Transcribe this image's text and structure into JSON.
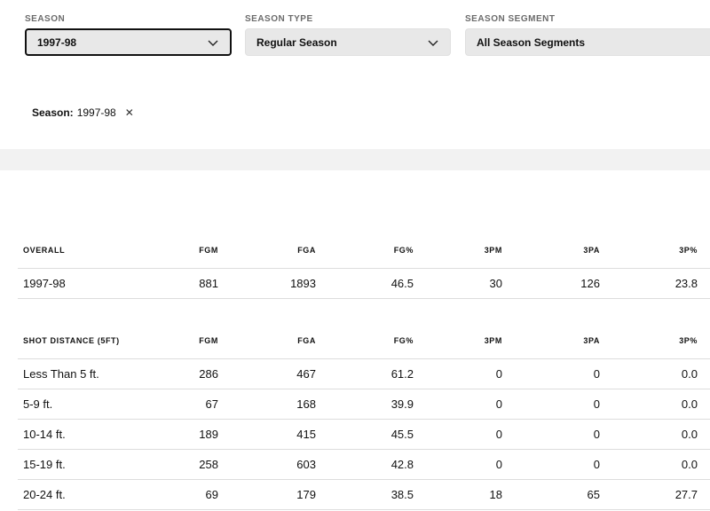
{
  "filters": {
    "season": {
      "label": "SEASON",
      "value": "1997-98"
    },
    "season_type": {
      "label": "SEASON TYPE",
      "value": "Regular Season"
    },
    "season_segment": {
      "label": "SEASON SEGMENT",
      "value": "All Season Segments"
    }
  },
  "chip": {
    "key": "Season:",
    "value": "1997-98",
    "remove_glyph": "✕"
  },
  "overall": {
    "headers": [
      "OVERALL",
      "FGM",
      "FGA",
      "FG%",
      "3PM",
      "3PA",
      "3P%"
    ],
    "rows": [
      [
        "1997-98",
        "881",
        "1893",
        "46.5",
        "30",
        "126",
        "23.8"
      ]
    ]
  },
  "shot_distance": {
    "headers": [
      "SHOT DISTANCE (5FT)",
      "FGM",
      "FGA",
      "FG%",
      "3PM",
      "3PA",
      "3P%"
    ],
    "rows": [
      [
        "Less Than 5 ft.",
        "286",
        "467",
        "61.2",
        "0",
        "0",
        "0.0"
      ],
      [
        "5-9 ft.",
        "67",
        "168",
        "39.9",
        "0",
        "0",
        "0.0"
      ],
      [
        "10-14 ft.",
        "189",
        "415",
        "45.5",
        "0",
        "0",
        "0.0"
      ],
      [
        "15-19 ft.",
        "258",
        "603",
        "42.8",
        "0",
        "0",
        "0.0"
      ],
      [
        "20-24 ft.",
        "69",
        "179",
        "38.5",
        "18",
        "65",
        "27.7"
      ]
    ]
  }
}
